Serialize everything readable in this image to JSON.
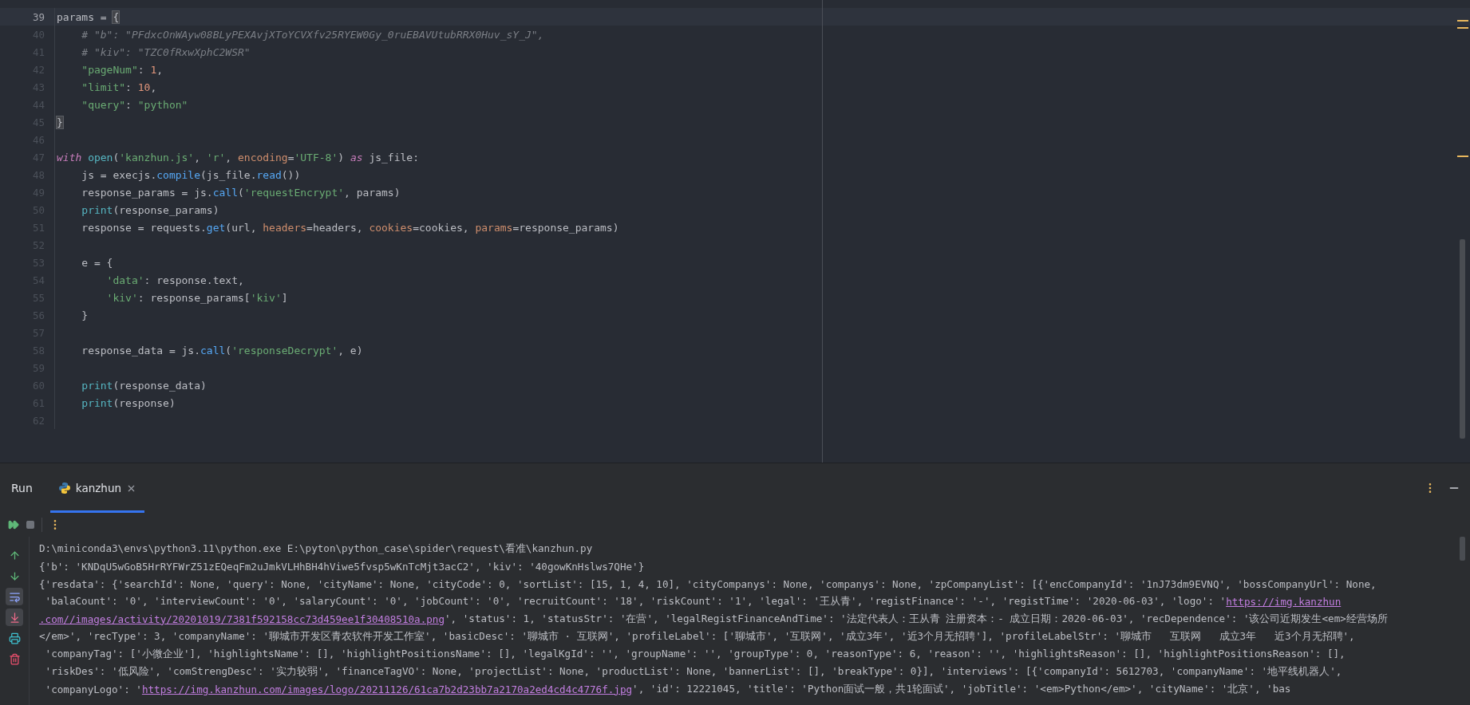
{
  "editor": {
    "lines": [
      {
        "number": "39",
        "current": true,
        "tokens": [
          {
            "kind": "plain",
            "text": "params = "
          },
          {
            "kind": "match",
            "text": "{"
          }
        ]
      },
      {
        "number": "40",
        "current": false,
        "tokens": [
          {
            "kind": "comment",
            "text": "    # \"b\": \"PFdxcOnWAyw08BLyPEXAvjXToYCVXfv25RYEW0Gy_0ruEBAVUtubRRX0Huv_sY_J\","
          }
        ]
      },
      {
        "number": "41",
        "current": false,
        "tokens": [
          {
            "kind": "comment",
            "text": "    # \"kiv\": \"TZC0fRxwXphC2WSR\""
          }
        ]
      },
      {
        "number": "42",
        "current": false,
        "tokens": [
          {
            "kind": "string",
            "text": "    \"pageNum\""
          },
          {
            "kind": "plain",
            "text": ": "
          },
          {
            "kind": "number",
            "text": "1"
          },
          {
            "kind": "plain",
            "text": ","
          }
        ]
      },
      {
        "number": "43",
        "current": false,
        "tokens": [
          {
            "kind": "string",
            "text": "    \"limit\""
          },
          {
            "kind": "plain",
            "text": ": "
          },
          {
            "kind": "number",
            "text": "10"
          },
          {
            "kind": "plain",
            "text": ","
          }
        ]
      },
      {
        "number": "44",
        "current": false,
        "tokens": [
          {
            "kind": "string",
            "text": "    \"query\""
          },
          {
            "kind": "plain",
            "text": ": "
          },
          {
            "kind": "string",
            "text": "\"python\""
          }
        ]
      },
      {
        "number": "45",
        "current": false,
        "tokens": [
          {
            "kind": "match",
            "text": "}"
          }
        ]
      },
      {
        "number": "46",
        "current": false
      },
      {
        "number": "47",
        "current": false,
        "tokens": [
          {
            "kind": "keyword",
            "text": "with"
          },
          {
            "kind": "builtin",
            "text": " open"
          },
          {
            "kind": "plain",
            "text": "("
          },
          {
            "kind": "string",
            "text": "'kanzhun.js'"
          },
          {
            "kind": "plain",
            "text": ", "
          },
          {
            "kind": "string",
            "text": "'r'"
          },
          {
            "kind": "plain",
            "text": ", "
          },
          {
            "kind": "kwarg",
            "text": "encoding"
          },
          {
            "kind": "plain",
            "text": "="
          },
          {
            "kind": "string",
            "text": "'UTF-8'"
          },
          {
            "kind": "plain",
            "text": ") "
          },
          {
            "kind": "keyword",
            "text": "as"
          },
          {
            "kind": "plain",
            "text": " js_file:"
          }
        ]
      },
      {
        "number": "48",
        "current": false,
        "tokens": [
          {
            "kind": "plain",
            "text": "    js = execjs."
          },
          {
            "kind": "call",
            "text": "compile"
          },
          {
            "kind": "plain",
            "text": "(js_file."
          },
          {
            "kind": "call",
            "text": "read"
          },
          {
            "kind": "plain",
            "text": "())"
          }
        ]
      },
      {
        "number": "49",
        "current": false,
        "tokens": [
          {
            "kind": "plain",
            "text": "    response_params = js."
          },
          {
            "kind": "call",
            "text": "call"
          },
          {
            "kind": "plain",
            "text": "("
          },
          {
            "kind": "string",
            "text": "'requestEncrypt'"
          },
          {
            "kind": "plain",
            "text": ", params)"
          }
        ]
      },
      {
        "number": "50",
        "current": false,
        "tokens": [
          {
            "kind": "builtin",
            "text": "    print"
          },
          {
            "kind": "plain",
            "text": "(response_params)"
          }
        ]
      },
      {
        "number": "51",
        "current": false,
        "tokens": [
          {
            "kind": "plain",
            "text": "    response = requests."
          },
          {
            "kind": "call",
            "text": "get"
          },
          {
            "kind": "plain",
            "text": "(url, "
          },
          {
            "kind": "kwarg",
            "text": "headers"
          },
          {
            "kind": "plain",
            "text": "=headers, "
          },
          {
            "kind": "kwarg",
            "text": "cookies"
          },
          {
            "kind": "plain",
            "text": "=cookies, "
          },
          {
            "kind": "kwarg",
            "text": "params"
          },
          {
            "kind": "plain",
            "text": "=response_params)"
          }
        ]
      },
      {
        "number": "52",
        "current": false
      },
      {
        "number": "53",
        "current": false,
        "tokens": [
          {
            "kind": "plain",
            "text": "    e = {"
          }
        ]
      },
      {
        "number": "54",
        "current": false,
        "tokens": [
          {
            "kind": "string",
            "text": "        'data'"
          },
          {
            "kind": "plain",
            "text": ": response.text,"
          }
        ]
      },
      {
        "number": "55",
        "current": false,
        "tokens": [
          {
            "kind": "string",
            "text": "        'kiv'"
          },
          {
            "kind": "plain",
            "text": ": response_params["
          },
          {
            "kind": "string",
            "text": "'kiv'"
          },
          {
            "kind": "plain",
            "text": "]"
          }
        ]
      },
      {
        "number": "56",
        "current": false,
        "tokens": [
          {
            "kind": "plain",
            "text": "    }"
          }
        ]
      },
      {
        "number": "57",
        "current": false
      },
      {
        "number": "58",
        "current": false,
        "tokens": [
          {
            "kind": "plain",
            "text": "    response_data = js."
          },
          {
            "kind": "call",
            "text": "call"
          },
          {
            "kind": "plain",
            "text": "("
          },
          {
            "kind": "string",
            "text": "'responseDecrypt'"
          },
          {
            "kind": "plain",
            "text": ", e)"
          }
        ]
      },
      {
        "number": "59",
        "current": false
      },
      {
        "number": "60",
        "current": false,
        "tokens": [
          {
            "kind": "builtin",
            "text": "    print"
          },
          {
            "kind": "plain",
            "text": "(response_data)"
          }
        ]
      },
      {
        "number": "61",
        "current": false,
        "tokens": [
          {
            "kind": "builtin",
            "text": "    print"
          },
          {
            "kind": "plain",
            "text": "(response)"
          }
        ]
      },
      {
        "number": "62",
        "current": false
      }
    ]
  },
  "run_panel": {
    "title": "Run",
    "tabs": [
      {
        "label": "kanzhun",
        "selected": true
      }
    ],
    "side_tools": [
      {
        "kind": "up",
        "on": false
      },
      {
        "kind": "down",
        "on": false
      },
      {
        "kind": "wrap",
        "on": true
      },
      {
        "kind": "scroll-end",
        "on": true
      },
      {
        "kind": "print",
        "on": false
      },
      {
        "kind": "delete",
        "on": false
      }
    ],
    "console": [
      [
        {
          "kind": "plain",
          "text": "D:\\miniconda3\\envs\\python3.11\\python.exe E:\\pyton\\python_case\\spider\\request\\看准\\kanzhun.py"
        }
      ],
      [
        {
          "kind": "plain",
          "text": "{'b': 'KNDqU5wGoB5HrRYFWrZ51zEQeqFm2uJmkVLHhBH4hViwe5fvsp5wKnTcMjt3acC2', 'kiv': '40gowKnHslws7QHe'}"
        }
      ],
      [
        {
          "kind": "plain",
          "text": "{'resdata': {'searchId': None, 'query': None, 'cityName': None, 'cityCode': 0, 'sortList': [15, 1, 4, 10], 'cityCompanys': None, 'companys': None, 'zpCompanyList': [{'encCompanyId': '1nJ73dm9EVNQ', 'bossCompanyUrl': None,"
        }
      ],
      [
        {
          "kind": "plain",
          "text": " 'balaCount': '0', 'interviewCount': '0', 'salaryCount': '0', 'jobCount': '0', 'recruitCount': '18', 'riskCount': '1', 'legal': '王从青', 'registFinance': '-', 'registTime': '2020-06-03', 'logo': '"
        },
        {
          "kind": "link",
          "text": "https://img.kanzhun"
        }
      ],
      [
        {
          "kind": "link",
          "text": ".com//images/activity/20201019/7381f592158cc73d459ee1f30408510a.png"
        },
        {
          "kind": "plain",
          "text": "', 'status': 1, 'statusStr': '在营', 'legalRegistFinanceAndTime': '法定代表人：王从青 注册资本：- 成立日期：2020-06-03', 'recDependence': '该公司近期发生<em>经营场所"
        }
      ],
      [
        {
          "kind": "plain",
          "text": "</em>', 'recType': 3, 'companyName': '聊城市开发区青农软件开发工作室', 'basicDesc': '聊城市 · 互联网', 'profileLabel': ['聊城市', '互联网', '成立3年', '近3个月无招聘'], 'profileLabelStr': '聊城市   互联网   成立3年   近3个月无招聘',"
        }
      ],
      [
        {
          "kind": "plain",
          "text": " 'companyTag': ['小微企业'], 'highlightsName': [], 'highlightPositionsName': [], 'legalKgId': '', 'groupName': '', 'groupType': 0, 'reasonType': 6, 'reason': '', 'highlightsReason': [], 'highlightPositionsReason': [],"
        }
      ],
      [
        {
          "kind": "plain",
          "text": " 'riskDes': '低风险', 'comStrengDesc': '实力较弱', 'financeTagVO': None, 'projectList': None, 'productList': None, 'bannerList': [], 'breakType': 0}], 'interviews': [{'companyId': 5612703, 'companyName': '地平线机器人',"
        }
      ],
      [
        {
          "kind": "plain",
          "text": " 'companyLogo': '"
        },
        {
          "kind": "link",
          "text": "https://img.kanzhun.com/images/logo/20211126/61ca7b2d23bb7a2170a2ed4cd4c4776f.jpg"
        },
        {
          "kind": "plain",
          "text": "', 'id': 12221045, 'title': 'Python面试一般，共1轮面试', 'jobTitle': '<em>Python</em>', 'cityName': '北京', 'bas"
        }
      ]
    ]
  }
}
